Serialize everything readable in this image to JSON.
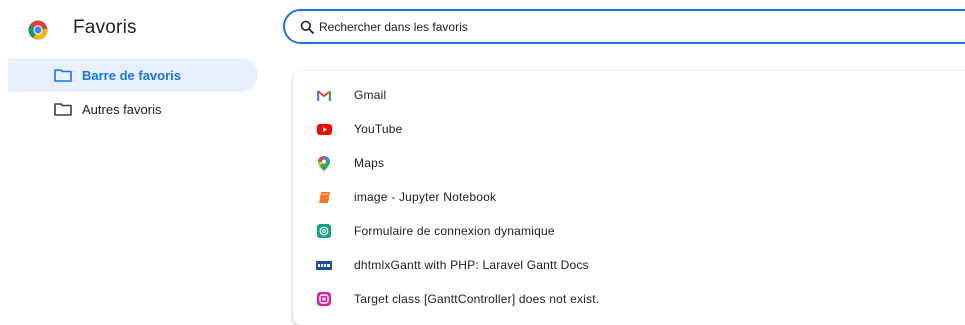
{
  "app": {
    "title": "Favoris"
  },
  "search": {
    "placeholder": "Rechercher dans les favoris",
    "value": ""
  },
  "sidebar": {
    "items": [
      {
        "label": "Barre de favoris",
        "selected": true,
        "icon": "folder-icon"
      },
      {
        "label": "Autres favoris",
        "selected": false,
        "icon": "folder-icon"
      }
    ]
  },
  "bookmarks": [
    {
      "title": "Gmail",
      "icon": "gmail-icon"
    },
    {
      "title": "YouTube",
      "icon": "youtube-icon"
    },
    {
      "title": "Maps",
      "icon": "maps-pin-icon"
    },
    {
      "title": "image - Jupyter Notebook",
      "icon": "jupyter-icon"
    },
    {
      "title": "Formulaire de connexion dynamique",
      "icon": "chatgpt-icon"
    },
    {
      "title": "dhtmlxGantt with PHP: Laravel Gantt Docs",
      "icon": "dhtmlx-icon"
    },
    {
      "title": "Target class [GanttController] does not exist.",
      "icon": "laragon-icon"
    }
  ],
  "colors": {
    "accent": "#1a73e8",
    "selected_bg": "#e8f0fe"
  }
}
